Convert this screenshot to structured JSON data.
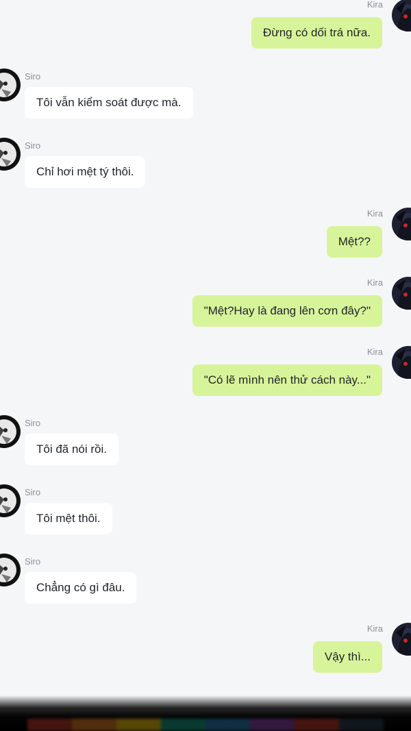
{
  "participants": {
    "left": {
      "name": "Siro",
      "avatar_icon": "siro-avatar-icon"
    },
    "right": {
      "name": "Kira",
      "avatar_icon": "kira-avatar-icon"
    }
  },
  "colors": {
    "background": "#f5f6f8",
    "left_bubble": "#ffffff",
    "right_bubble": "#d7f49a",
    "name_text": "#8b8f95"
  },
  "messages": [
    {
      "side": "right",
      "sender": "Kira",
      "text": "Đừng có dối trá nữa."
    },
    {
      "side": "left",
      "sender": "Siro",
      "text": "Tôi vẫn kiểm soát được mà."
    },
    {
      "side": "left",
      "sender": "Siro",
      "text": "Chỉ hơi mệt tý thôi."
    },
    {
      "side": "right",
      "sender": "Kira",
      "text": "Mệt??"
    },
    {
      "side": "right",
      "sender": "Kira",
      "text": "\"Mệt?Hay là đang lên cơn đây?\""
    },
    {
      "side": "right",
      "sender": "Kira",
      "text": "\"Có lẽ mình nên thử cách này...\""
    },
    {
      "side": "left",
      "sender": "Siro",
      "text": "Tôi đã nói rồi."
    },
    {
      "side": "left",
      "sender": "Siro",
      "text": "Tôi mệt thôi."
    },
    {
      "side": "left",
      "sender": "Siro",
      "text": "Chẳng có gì đâu."
    },
    {
      "side": "right",
      "sender": "Kira",
      "text": "Vậy thì..."
    }
  ]
}
